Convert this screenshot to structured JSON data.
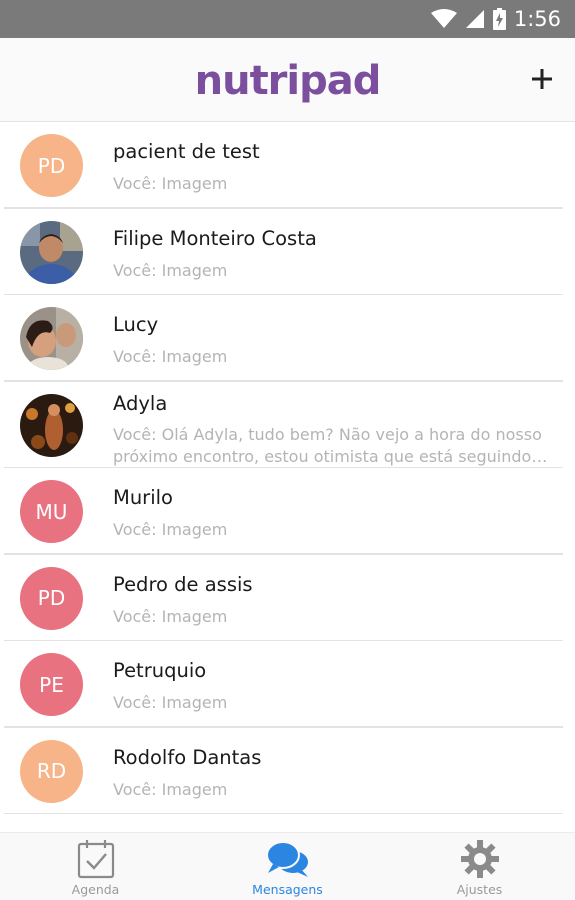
{
  "status_bar": {
    "time": "1:56",
    "icons": [
      "wifi-icon",
      "signal-icon",
      "battery-icon"
    ]
  },
  "header": {
    "logo": "nutripad",
    "add_icon": "plus-icon"
  },
  "conversations": [
    {
      "name": "pacient de test",
      "preview": "Você: Imagem",
      "initials": "PD",
      "avatar_color": "#f7b488"
    },
    {
      "name": "Filipe Monteiro Costa",
      "preview": "Você: Imagem",
      "avatar_type": "photo"
    },
    {
      "name": "Lucy",
      "preview": "Você: Imagem",
      "avatar_type": "photo"
    },
    {
      "name": "Adyla",
      "preview": "Você: Olá Adyla, tudo bem? Não vejo a hora do nosso próximo encontro, estou otimista que está seguindo…",
      "avatar_type": "photo"
    },
    {
      "name": "Murilo",
      "preview": "Você: Imagem",
      "initials": "MU",
      "avatar_color": "#e8727f"
    },
    {
      "name": "Pedro de assis",
      "preview": "Você: Imagem",
      "initials": "PD",
      "avatar_color": "#e8727f"
    },
    {
      "name": "Petruquio",
      "preview": "Você: Imagem",
      "initials": "PE",
      "avatar_color": "#e8727f"
    },
    {
      "name": "Rodolfo Dantas",
      "preview": "Você: Imagem",
      "initials": "RD",
      "avatar_color": "#f7b488"
    }
  ],
  "bottom_nav": [
    {
      "label": "Agenda",
      "icon": "calendar-check-icon",
      "active": false
    },
    {
      "label": "Mensagens",
      "icon": "chat-bubbles-icon",
      "active": true
    },
    {
      "label": "Ajustes",
      "icon": "gear-icon",
      "active": false
    }
  ],
  "colors": {
    "brand": "#7b4e9e",
    "active_tab": "#2b86e2",
    "status_bar": "#7a7a7a"
  }
}
